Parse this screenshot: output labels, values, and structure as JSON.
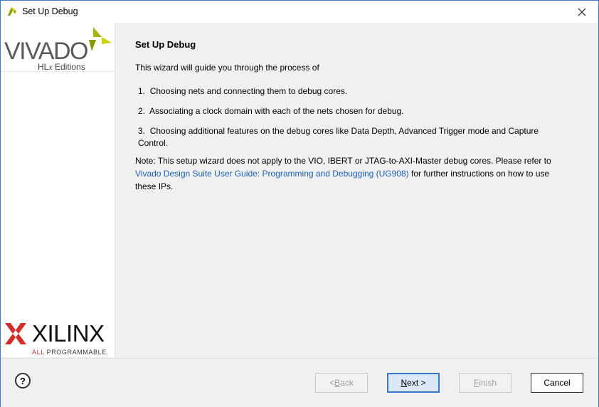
{
  "window": {
    "title": "Set Up Debug"
  },
  "sidebar": {
    "vivado_logo_text": "VIVADO",
    "vivado_edition_prefix": "HL",
    "vivado_edition_x": "x",
    "vivado_edition_suffix": " Editions",
    "xilinx_logo_text": "XILINX",
    "xilinx_tagline_all": "ALL",
    "xilinx_tagline_rest": " PROGRAMMABLE."
  },
  "main": {
    "heading": "Set Up Debug",
    "intro": "This wizard will guide you through the process of",
    "steps": [
      {
        "number": "1.",
        "text": "Choosing nets and connecting them to debug cores."
      },
      {
        "number": "2.",
        "text": "Associating a clock domain with each of the nets chosen for debug."
      },
      {
        "number": "3.",
        "text": "Choosing additional features on the debug cores like Data Depth, Advanced Trigger mode and Capture Control."
      }
    ],
    "note_before": "Note: This setup wizard does not apply to the VIO, IBERT or JTAG-to-AXI-Master debug cores. Please refer to ",
    "note_link": "Vivado Design Suite User Guide: Programming and Debugging (UG908)",
    "note_after": " for further instructions on how to use these IPs."
  },
  "footer": {
    "help_label": "?",
    "back_prefix": "< ",
    "back_mnemonic": "B",
    "back_rest": "ack",
    "next_mnemonic": "N",
    "next_rest": "ext >",
    "finish_mnemonic": "F",
    "finish_rest": "inish",
    "cancel_label": "Cancel"
  },
  "colors": {
    "accent": "#3c78c8",
    "link": "#1a5fb4",
    "xilinx_red": "#d22d28",
    "vivado_green": "#a8b400"
  },
  "icons": {
    "title": "vivado-app-icon",
    "close": "close-icon",
    "help": "help-icon"
  }
}
